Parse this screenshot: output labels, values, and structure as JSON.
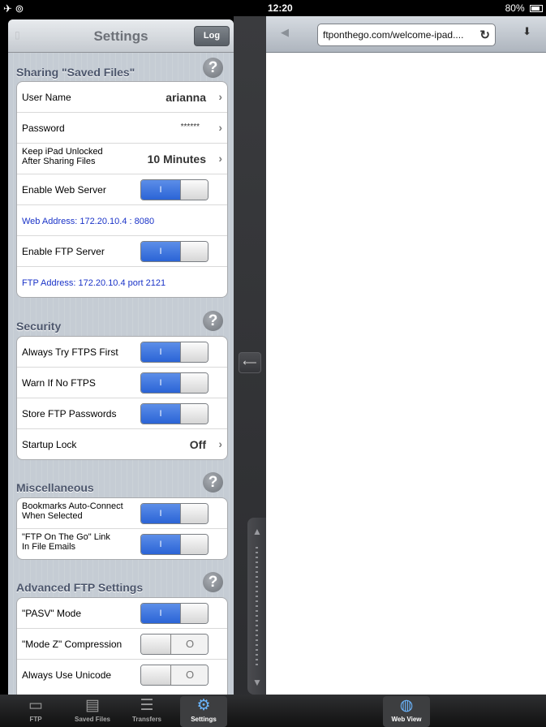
{
  "status_bar": {
    "left_icons": "✈ ⊚",
    "time": "12:20",
    "battery": "80%"
  },
  "settings": {
    "title": "Settings",
    "log_label": "Log",
    "sharing": {
      "header": "Sharing \"Saved Files\"",
      "user_name_label": "User Name",
      "user_name_value": "arianna",
      "password_label": "Password",
      "password_value": "******",
      "unlock_label_1": "Keep iPad Unlocked",
      "unlock_label_2": "After Sharing Files",
      "unlock_value": "10 Minutes",
      "web_server_label": "Enable Web Server",
      "web_address": "Web Address: 172.20.10.4 : 8080",
      "ftp_server_label": "Enable FTP Server",
      "ftp_address": "FTP Address: 172.20.10.4 port 2121"
    },
    "security": {
      "header": "Security",
      "ftps_first_label": "Always Try FTPS First",
      "warn_label": "Warn If No FTPS",
      "store_label": "Store FTP Passwords",
      "startup_label": "Startup Lock",
      "startup_value": "Off"
    },
    "misc": {
      "header": "Miscellaneous",
      "bookmarks_label_1": "Bookmarks Auto-Connect",
      "bookmarks_label_2": "When Selected",
      "link_label_1": "\"FTP On The Go\" Link",
      "link_label_2": "In File Emails"
    },
    "advanced": {
      "header": "Advanced FTP Settings",
      "pasv_label": "\"PASV\" Mode",
      "modez_label": "\"Mode Z\" Compression",
      "unicode_label": "Always Use Unicode"
    },
    "switch_on_glyph": "I",
    "switch_off_glyph": "O"
  },
  "web": {
    "url": "ftponthego.com/welcome-ipad....",
    "back_icon": "back-arrow-icon",
    "reload_icon": "reload-icon",
    "download_icon": "download-icon"
  },
  "tabs": [
    {
      "label": "FTP",
      "icon": "monitor-icon"
    },
    {
      "label": "Saved Files",
      "icon": "cabinet-icon"
    },
    {
      "label": "Transfers",
      "icon": "list-icon"
    },
    {
      "label": "Settings",
      "icon": "gear-icon"
    },
    {
      "label": "Web View",
      "icon": "globe-icon"
    }
  ],
  "colors": {
    "switch_on": "#2b64d6",
    "link_text": "#1a33c8",
    "group_bg": "#c5ccd4"
  }
}
